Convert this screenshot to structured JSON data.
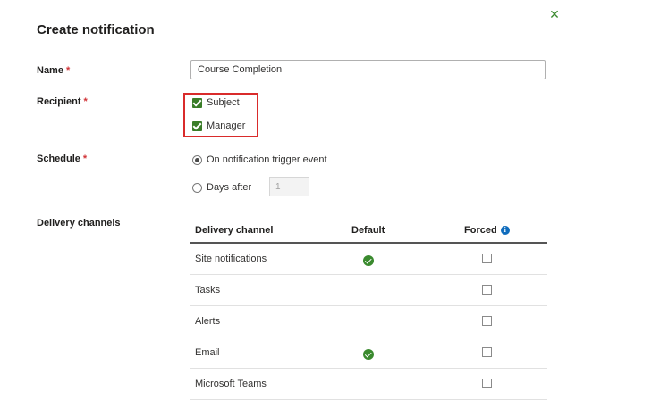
{
  "dialog": {
    "title": "Create notification",
    "close_icon": "✕"
  },
  "fields": {
    "name": {
      "label": "Name",
      "required_mark": "*",
      "value": "Course Completion"
    },
    "recipient": {
      "label": "Recipient",
      "required_mark": "*",
      "options": [
        {
          "label": "Subject",
          "checked": true
        },
        {
          "label": "Manager",
          "checked": true
        }
      ]
    },
    "schedule": {
      "label": "Schedule",
      "required_mark": "*",
      "options": [
        {
          "label": "On notification trigger event",
          "selected": true
        },
        {
          "label": "Days after",
          "selected": false
        }
      ],
      "days_value": "1"
    },
    "delivery": {
      "label": "Delivery channels",
      "columns": [
        "Delivery channel",
        "Default",
        "Forced"
      ],
      "info_icon": "i",
      "rows": [
        {
          "channel": "Site notifications",
          "default": true,
          "forced": false
        },
        {
          "channel": "Tasks",
          "default": false,
          "forced": false
        },
        {
          "channel": "Alerts",
          "default": false,
          "forced": false
        },
        {
          "channel": "Email",
          "default": true,
          "forced": false
        },
        {
          "channel": "Microsoft Teams",
          "default": false,
          "forced": false
        }
      ]
    }
  },
  "colors": {
    "accent_green": "#3a8a2e",
    "highlight_red": "#d92b2b",
    "info_blue": "#0f6cbd",
    "required_red": "#d13438"
  }
}
